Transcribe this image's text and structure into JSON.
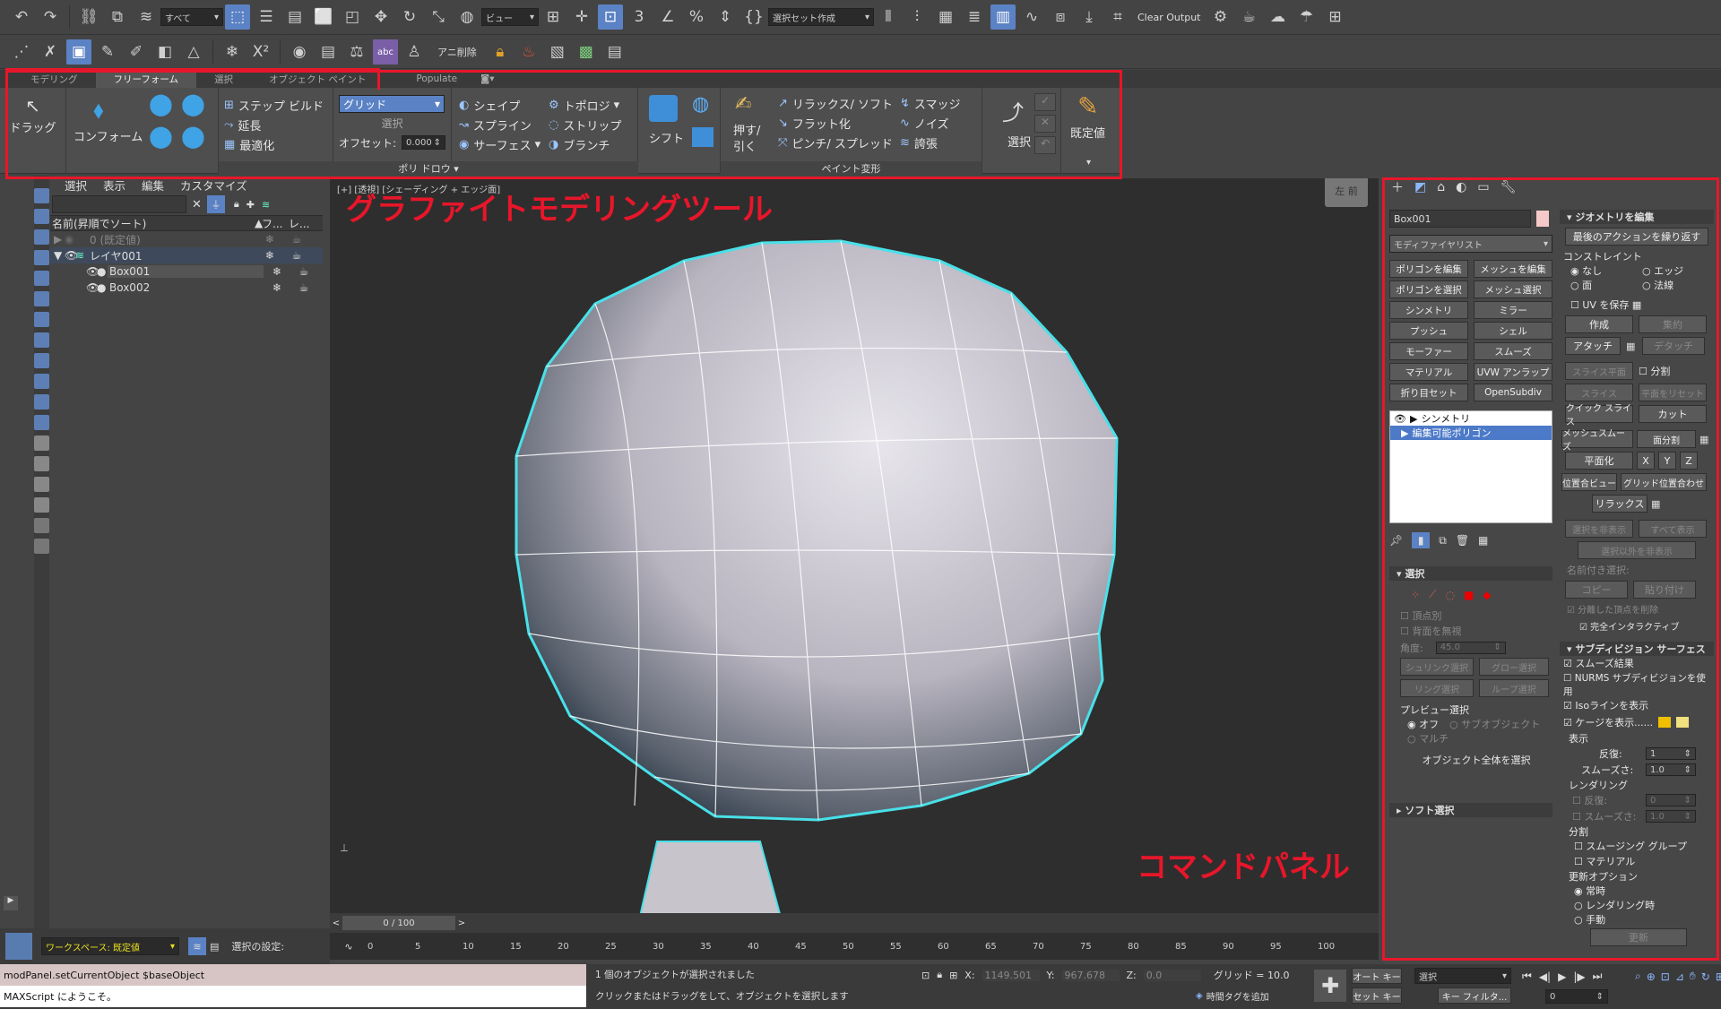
{
  "toolbar": {
    "filter_select": "すべて",
    "view_select": "ビュー",
    "selection_set": "選択セット作成",
    "clear_output": "Clear Output",
    "anim_delete": "アニ削除"
  },
  "ribbon": {
    "tabs": [
      "モデリング",
      "フリーフォーム",
      "選択",
      "オブジェクト ペイント",
      "Populate"
    ],
    "drag": "ドラッグ",
    "conform": "コンフォーム",
    "step_build": "ステップ ビルド",
    "extend": "延長",
    "optimize": "最適化",
    "grid": "グリッド",
    "select_small": "選択",
    "offset_label": "オフセット:",
    "offset_value": "0.000",
    "shape": "シェイプ",
    "spline": "スプライン",
    "surface": "サーフェス",
    "topology": "トポロジ",
    "strips": "ストリップ",
    "branches": "ブランチ",
    "shift": "シフト",
    "push_pull": "押す/\n引く",
    "relax_soft": "リラックス/ ソフト",
    "flatten": "フラット化",
    "pinch_spread": "ピンチ/ スプレッド",
    "smudge": "スマッジ",
    "noise": "ノイズ",
    "exaggerate": "誇張",
    "select_big": "選択",
    "defaults": "既定値",
    "group_polydraw": "ポリ ドロウ ▾",
    "group_paint": "ペイント変形"
  },
  "annotations": {
    "graphite": "グラファイトモデリングツール",
    "command": "コマンドパネル"
  },
  "scene": {
    "menu": [
      "選択",
      "表示",
      "編集",
      "カスタマイズ"
    ],
    "col_name": "名前(昇順でソート)",
    "col_freeze": "フ...",
    "col_render": "レ...",
    "rows": [
      "0 (既定値)",
      "レイヤ001",
      "Box001",
      "Box002"
    ]
  },
  "viewport": {
    "label": "[+] [透視] [シェーディング + エッジ面]",
    "viewcube": "左 前"
  },
  "timeline": {
    "frame": "0 / 100",
    "ticks": [
      "0",
      "5",
      "10",
      "15",
      "20",
      "25",
      "30",
      "35",
      "40",
      "45",
      "50",
      "55",
      "60",
      "65",
      "70",
      "75",
      "80",
      "85",
      "90",
      "95",
      "100"
    ]
  },
  "cmd": {
    "object_name": "Box001",
    "modifier_list": "モディファイヤリスト",
    "modifier_buttons": [
      "ポリゴンを編集",
      "メッシュを編集",
      "ポリゴンを選択",
      "メッシュ選択",
      "シンメトリ",
      "ミラー",
      "プッシュ",
      "シェル",
      "モーファー",
      "スムーズ",
      "マテリアル",
      "UVW アンラップ",
      "折り目セット",
      "OpenSubdiv"
    ],
    "stack": [
      "シンメトリ",
      "編集可能ポリゴン"
    ],
    "sel_title": "選択",
    "by_vertex": "頂点別",
    "ignore_back": "背面を無視",
    "angle_label": "角度:",
    "angle_value": "45.0",
    "shrink": "シュリンク選択",
    "grow": "グロー選択",
    "ring": "リング選択",
    "loop": "ループ選択",
    "preview_title": "プレビュー選択",
    "off": "オフ",
    "subobj": "サブオブジェクト",
    "multi": "マルチ",
    "whole": "オブジェクト全体を選択",
    "soft_title": "ソフト選択",
    "geom_title": "ジオメトリを編集",
    "repeat": "最後のアクションを繰り返す",
    "constraint": "コンストレイント",
    "none": "なし",
    "edge": "エッジ",
    "face": "面",
    "normal": "法線",
    "keep_uv": "UV を保存",
    "create": "作成",
    "collapse": "集約",
    "attach": "アタッチ",
    "detach": "デタッチ",
    "slice_plane": "スライス平面",
    "split": "分割",
    "slice": "スライス",
    "reset_plane": "平面をリセット",
    "quickslice": "クイック スライス",
    "cut": "カット",
    "meshsmooth": "メッシュスムーズ",
    "tessellate": "面分割",
    "make_planar": "平面化",
    "x": "X",
    "y": "Y",
    "z": "Z",
    "view_align": "位置合ビュー",
    "grid_align": "グリッド位置合わせ",
    "relax": "リラックス",
    "hide_sel": "選択を非表示",
    "unhide_all": "すべて表示",
    "hide_unsel": "選択以外を非表示",
    "named_sel": "名前付き選択:",
    "copy": "コピー",
    "paste": "貼り付け",
    "delete_iso": "分離した頂点を削除",
    "full_interactive": "完全インタラクティブ",
    "subdiv_title": "サブディビジョン サーフェス",
    "smooth_result": "スムーズ結果",
    "nurms": "NURMS サブディビジョンを使用",
    "iso_display": "Isoラインを表示",
    "show_cage": "ケージを表示......",
    "display": "表示",
    "iterations": "反復:",
    "iter_val": "1",
    "smoothness": "スムーズさ:",
    "smooth_val": "1.0",
    "render": "レンダリング",
    "r_iter_val": "0",
    "r_smooth_val": "1.0",
    "separate": "分割",
    "smoothing_groups": "スムージング グループ",
    "materials": "マテリアル",
    "update_options": "更新オプション",
    "always": "常時",
    "when_render": "レンダリング時",
    "manual": "手動",
    "update": "更新"
  },
  "status": {
    "script1": "modPanel.setCurrentObject $baseObject",
    "script2": "MAXScript にようこそ。",
    "selected": "1 個のオブジェクトが選択されました",
    "prompt": "クリックまたはドラッグをして、オブジェクトを選択します",
    "x_label": "X:",
    "x_val": "1149.501",
    "y_label": "Y:",
    "y_val": "967.678",
    "z_label": "Z:",
    "z_val": "0.0",
    "grid": "グリッド = 10.0",
    "add_time_tag": "時間タグを追加",
    "auto_key": "オート キー",
    "set_key": "セット キー",
    "key_select": "選択",
    "key_filters": "キー フィルタ...",
    "frame_field": "0",
    "workspace": "ワークスペース: 既定値",
    "sel_set_label": "選択の設定:"
  },
  "colors": {
    "accent": "#5b82c4",
    "annotation": "#e8162a",
    "cyan": "#49e0e8",
    "swatch": "#f5c9c9"
  }
}
